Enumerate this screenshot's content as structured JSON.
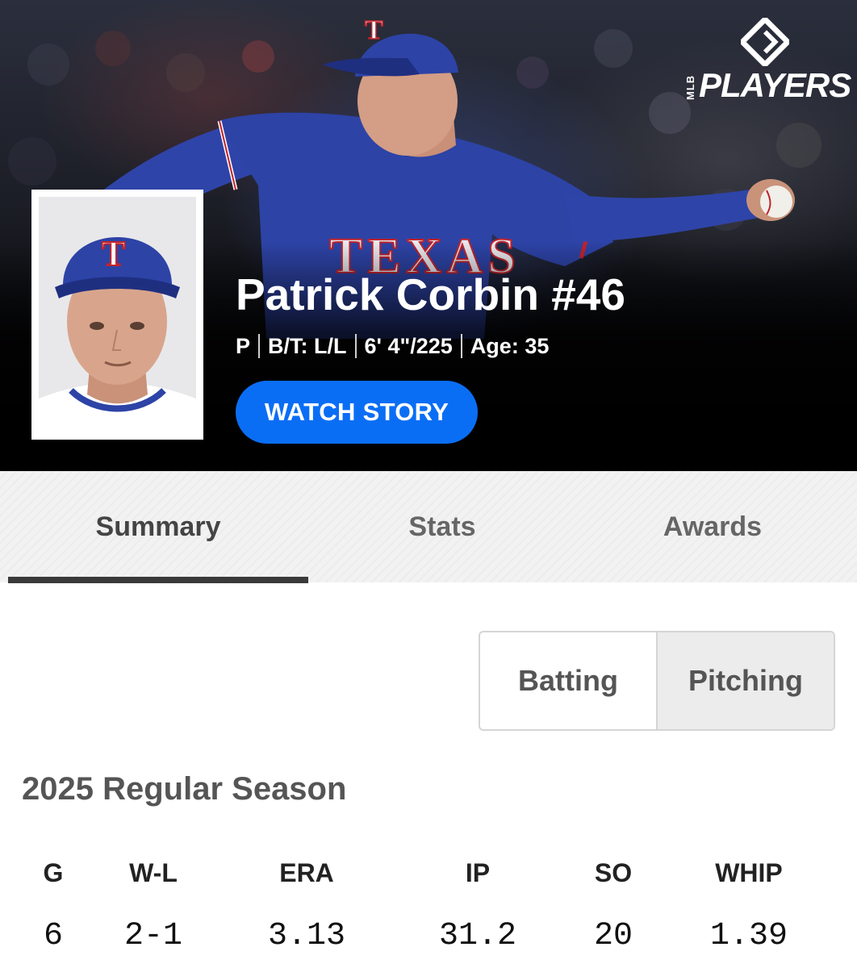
{
  "brand": {
    "small": "MLB",
    "name": "PLAYERS"
  },
  "player": {
    "name": "Patrick Corbin #46",
    "position": "P",
    "bats_throws": "B/T: L/L",
    "height_weight": "6' 4\"/225",
    "age": "Age: 35",
    "watch_label": "WATCH STORY"
  },
  "tabs": [
    {
      "label": "Summary",
      "active": true
    },
    {
      "label": "Stats",
      "active": false
    },
    {
      "label": "Awards",
      "active": false
    }
  ],
  "toggle": {
    "options": [
      "Batting",
      "Pitching"
    ],
    "selected": "Pitching"
  },
  "season": {
    "title": "2025 Regular Season",
    "headers": [
      "G",
      "W-L",
      "ERA",
      "IP",
      "SO",
      "WHIP"
    ],
    "values": [
      "6",
      "2-1",
      "3.13",
      "31.2",
      "20",
      "1.39"
    ]
  },
  "colors": {
    "accent_blue": "#0a6ef5",
    "team_blue": "#2a3f9c",
    "team_red": "#c0232c"
  },
  "icons": [
    "mlb-players-logo-icon",
    "player-headshot"
  ]
}
